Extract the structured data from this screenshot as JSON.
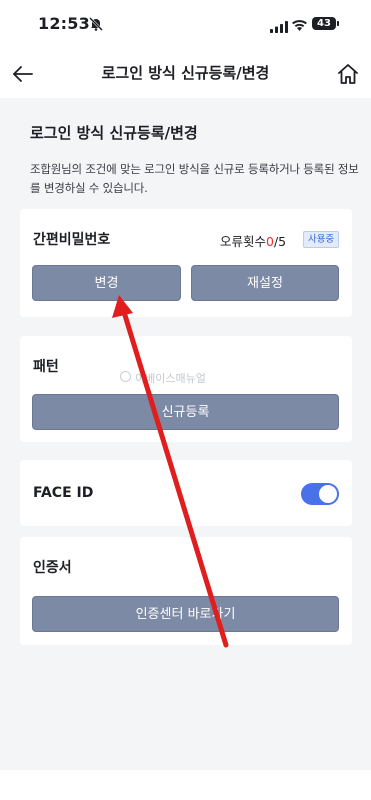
{
  "status_bar": {
    "time": "12:53",
    "battery": "43",
    "icons": [
      "bell-off-icon",
      "signal-icon",
      "wifi-icon",
      "battery-icon"
    ]
  },
  "header": {
    "title": "로그인 방식 신규등록/변경",
    "back_icon": "arrow-left-icon",
    "home_icon": "home-icon"
  },
  "intro": {
    "title": "로그인 방식 신규등록/변경",
    "description": "조합원님의 조건에 맞는 로그인 방식을 신규로 등록하거나 등록된 정보를 변경하실 수 있습니다."
  },
  "simple_password": {
    "title": "간편비밀번호",
    "error_label": "오류횟수",
    "error_current": "0",
    "error_max": "/5",
    "badge": "사용중",
    "change_button": "변경",
    "reset_button": "재설정"
  },
  "pattern": {
    "title": "패턴",
    "register_button": "신규등록"
  },
  "face_id": {
    "title": "FACE ID",
    "enabled": true
  },
  "certificate": {
    "title": "인증서",
    "center_button": "인증센터 바로가기"
  },
  "watermark": "이베이스매뉴얼",
  "colors": {
    "button": "#7d8aa5",
    "toggle_on": "#4a72e8",
    "badge_text": "#3b67d6",
    "error_red": "#e3302f",
    "annotation_arrow": "#e01e1e"
  }
}
